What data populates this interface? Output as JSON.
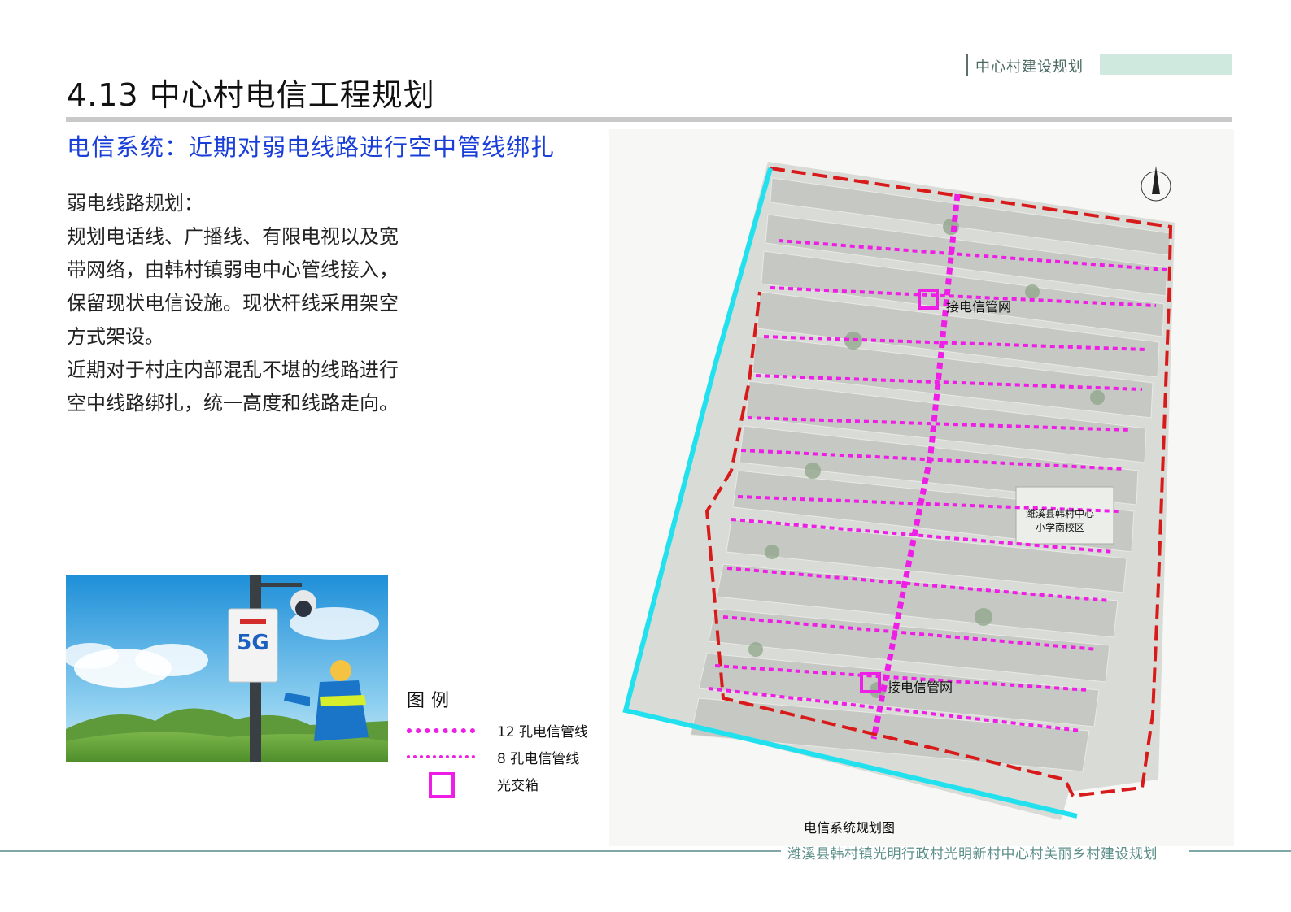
{
  "header": {
    "section_tag": "中心村建设规划",
    "title": "4.13 中心村电信工程规划",
    "subtitle": "电信系统：近期对弱电线路进行空中管线绑扎"
  },
  "body": {
    "paragraphs": [
      "弱电线路规划：",
      "规划电话线、广播线、有限电视以及宽带网络，由韩村镇弱电中心管线接入，保留现状电信设施。现状杆线采用架空方式架设。",
      "近期对于村庄内部混乱不堪的线路进行空中线路绑扎，统一高度和线路走向。"
    ]
  },
  "photo": {
    "brand_text": "5G"
  },
  "legend": {
    "title": "图例",
    "items": [
      {
        "label": "12 孔电信管线",
        "color": "#ee1ee6"
      },
      {
        "label": "8 孔电信管线",
        "color": "#ee1ee6"
      },
      {
        "label": "光交箱",
        "color": "#ee1ee6"
      }
    ]
  },
  "map": {
    "caption": "电信系统规划图",
    "labels": {
      "connect_top": "接电信管网",
      "connect_bottom": "接电信管网",
      "school_line1": "潍溪县韩村中心",
      "school_line2": "小学南校区"
    },
    "colors": {
      "telecom": "#ee1ee6",
      "boundary_red": "#d81a1a",
      "boundary_cyan": "#22e1ee"
    }
  },
  "footer": {
    "text": "潍溪县韩村镇光明行政村光明新村中心村美丽乡村建设规划"
  }
}
